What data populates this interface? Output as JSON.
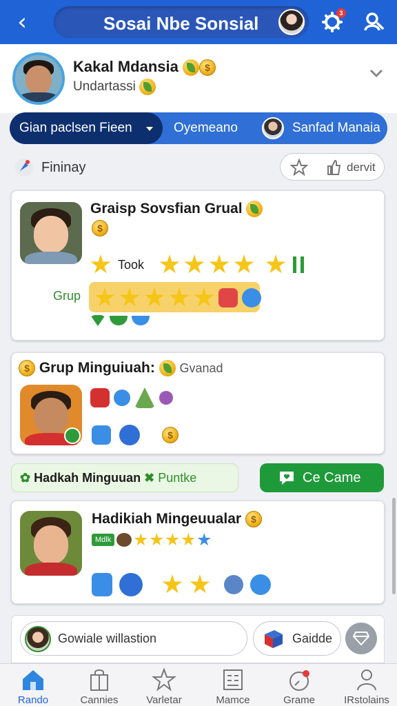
{
  "header": {
    "back_label": "‹",
    "title": "Sosai Nbe Sonsial",
    "notification_count": "3"
  },
  "profile": {
    "name": "Kakal Mdansia",
    "subtitle": "Undartassi"
  },
  "tabs": [
    {
      "label": "Gian paclsen Fieen"
    },
    {
      "label": "Oyemeano"
    },
    {
      "label": "Sanfad Manaia"
    }
  ],
  "filter": {
    "label": "Fininay",
    "pill_label": "dervit"
  },
  "cards": [
    {
      "title": "Graisp Sovsfian Grual",
      "rating_label": "Took",
      "group_label": "Grup"
    },
    {
      "title": "Grup Minguiuah:",
      "subtitle": "Gvanad"
    },
    {
      "title": "Hadikiah Mingeuualar",
      "tag": "Mdlk"
    }
  ],
  "banner": {
    "title": "Hadkah Minguuan",
    "subtitle": "Puntke"
  },
  "game_button": {
    "label": "Ce Came"
  },
  "bottom_card": {
    "invite_label": "Gowiale willastion",
    "guide_label": "Gaidde"
  },
  "nav": [
    {
      "label": "Rando"
    },
    {
      "label": "Cannies"
    },
    {
      "label": "Varletar"
    },
    {
      "label": "Mamce"
    },
    {
      "label": "Grame"
    },
    {
      "label": "IRstolains"
    }
  ],
  "colors": {
    "primary": "#1f63d6",
    "dark_tab": "#0e2f6e",
    "game_button": "#1f9a3a",
    "star": "#f5c518"
  },
  "icons": [
    "back-arrow-icon",
    "gear-icon",
    "user-search-icon",
    "chevron-down-icon",
    "star-icon",
    "thumb-icon",
    "heart-chat-icon",
    "home-icon",
    "shopping-bag-icon",
    "star-outline-icon",
    "grid-icon",
    "gauge-icon",
    "person-icon"
  ]
}
